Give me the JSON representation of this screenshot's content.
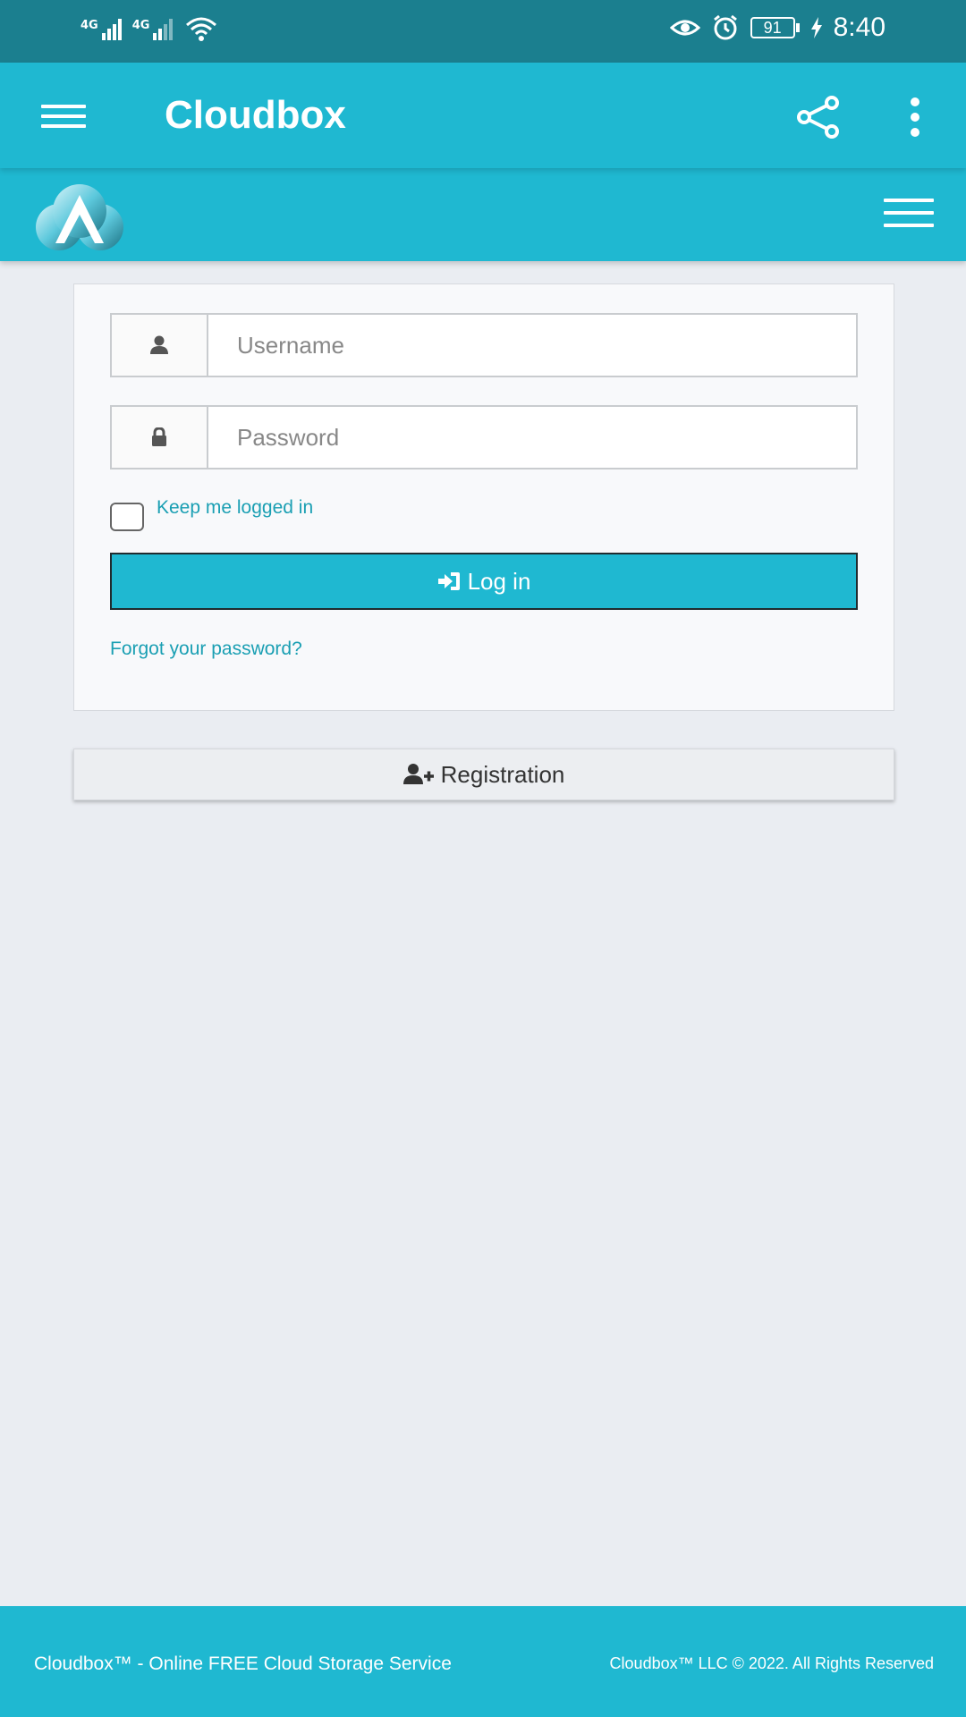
{
  "status_bar": {
    "net1": "4G",
    "net2": "4G",
    "battery": "91",
    "time": "8:40",
    "icons": [
      "signal-icon",
      "wifi-icon",
      "eye-icon",
      "alarm-icon",
      "battery-icon",
      "charging-icon"
    ]
  },
  "appbar": {
    "title": "Cloudbox",
    "icons": [
      "menu-icon",
      "share-icon",
      "more-vert-icon"
    ]
  },
  "site_header": {
    "icons": [
      "cloudbox-logo",
      "hamburger-menu-icon"
    ]
  },
  "login": {
    "username_placeholder": "Username",
    "password_placeholder": "Password",
    "remember_label": "Keep me logged in",
    "remember_checked": false,
    "login_label": "Log in",
    "forgot_label": "Forgot your password?",
    "icons": [
      "user-icon",
      "lock-icon",
      "sign-in-icon"
    ]
  },
  "registration": {
    "label": "Registration",
    "icon": "user-plus-icon"
  },
  "footer": {
    "left": "Cloudbox™ - Online FREE Cloud Storage Service",
    "right": "Cloudbox™ LLC © 2022. All Rights Reserved"
  },
  "colors": {
    "status_bar": "#1b7f8f",
    "primary": "#1fb8d1",
    "link": "#1a9fb3",
    "background": "#eaedf2"
  }
}
